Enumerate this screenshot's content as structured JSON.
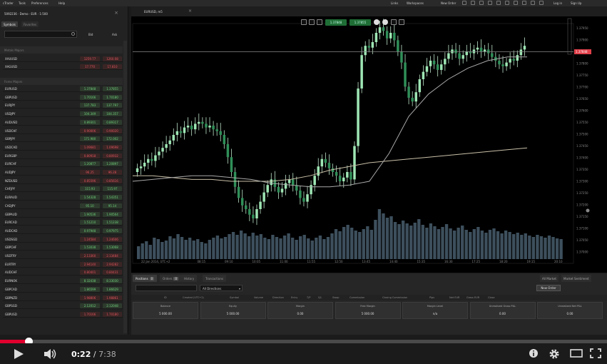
{
  "menubar": {
    "items": [
      "cTrader",
      "Tools",
      "Preferences",
      "Help"
    ],
    "right_items": [
      "Links",
      "Workspaces",
      "New Order",
      "Log in",
      "Sign Up"
    ]
  },
  "account": {
    "label": "5092236 · Demo · EUR · 1:500"
  },
  "symbol_tabs": [
    "Symbols",
    "Favorites"
  ],
  "quote_headers": {
    "bid": "Bid",
    "ask": "Ask"
  },
  "groups": [
    "Metals Majors",
    "Forex Majors"
  ],
  "quotes": [
    {
      "symbol": "XAUUSD",
      "bid": "1259.77",
      "ask": "1260.08",
      "trend": "down"
    },
    {
      "symbol": "XAGUSD",
      "bid": "17.770",
      "ask": "17.810",
      "trend": "down"
    },
    {
      "symbol": "EURUSD",
      "bid": "1.37848",
      "ask": "1.37855",
      "trend": "up"
    },
    {
      "symbol": "GBPUSD",
      "bid": "1.70166",
      "ask": "1.70180",
      "trend": "up"
    },
    {
      "symbol": "EURJPY",
      "bid": "137.783",
      "ask": "137.797",
      "trend": "up"
    },
    {
      "symbol": "USDJPY",
      "bid": "104.349",
      "ask": "104.357",
      "trend": "up"
    },
    {
      "symbol": "AUDUSD",
      "bid": "0.89301",
      "ask": "0.89317",
      "trend": "up"
    },
    {
      "symbol": "USDCHF",
      "bid": "0.90006",
      "ask": "0.90020",
      "trend": "down"
    },
    {
      "symbol": "GBPJPY",
      "bid": "171.980",
      "ask": "172.002",
      "trend": "up"
    },
    {
      "symbol": "USDCAD",
      "bid": "1.09681",
      "ask": "1.09698",
      "trend": "down"
    },
    {
      "symbol": "EURGBP",
      "bid": "0.80918",
      "ask": "0.80932",
      "trend": "down"
    },
    {
      "symbol": "EURCHF",
      "bid": "1.20877",
      "ask": "1.20897",
      "trend": "up"
    },
    {
      "symbol": "AUDJPY",
      "bid": "96.25",
      "ask": "96.28",
      "trend": "down"
    },
    {
      "symbol": "NZDUSD",
      "bid": "0.85596",
      "ask": "0.85616",
      "trend": "down"
    },
    {
      "symbol": "CHFJPY",
      "bid": "115.93",
      "ask": "115.97",
      "trend": "up"
    },
    {
      "symbol": "EURAUD",
      "bid": "1.54328",
      "ask": "1.54351",
      "trend": "up"
    },
    {
      "symbol": "CADJPY",
      "bid": "95.10",
      "ask": "95.14",
      "trend": "up"
    },
    {
      "symbol": "GBPAUD",
      "bid": "1.90536",
      "ask": "1.90564",
      "trend": "up"
    },
    {
      "symbol": "EURCAD",
      "bid": "1.51210",
      "ask": "1.51238",
      "trend": "up"
    },
    {
      "symbol": "AUDCAD",
      "bid": "0.97948",
      "ask": "0.97975",
      "trend": "up"
    },
    {
      "symbol": "USDSGD",
      "bid": "1.24584",
      "ask": "1.24606",
      "trend": "down"
    },
    {
      "symbol": "GBPCHF",
      "bid": "1.53038",
      "ask": "1.53068",
      "trend": "up"
    },
    {
      "symbol": "USDTRY",
      "bid": "2.13360",
      "ask": "2.13484",
      "trend": "down"
    },
    {
      "symbol": "EURTRY",
      "bid": "2.94140",
      "ask": "2.94282",
      "trend": "down"
    },
    {
      "symbol": "AUDCHF",
      "bid": "0.80401",
      "ask": "0.80431",
      "trend": "down"
    },
    {
      "symbol": "EURNOK",
      "bid": "8.32438",
      "ask": "8.33030",
      "trend": "up"
    },
    {
      "symbol": "GBPCAD",
      "bid": "1.86599",
      "ask": "1.86629",
      "trend": "up"
    },
    {
      "symbol": "GBPNZD",
      "bid": "1.98806",
      "ask": "1.98861",
      "trend": "down"
    },
    {
      "symbol": "GBPSGD",
      "bid": "2.12012",
      "ask": "2.12048",
      "trend": "up"
    },
    {
      "symbol": "GBPUSD",
      "bid": "1.70166",
      "ask": "1.70180",
      "trend": "down"
    }
  ],
  "chart_window": {
    "tab_label": "EURUSD, m5"
  },
  "chart_toolbar": {
    "sell_price": "1.37848",
    "buy_price": "1.37855"
  },
  "chart_data": {
    "type": "candlestick",
    "current_price": "1.37848",
    "y_ticks": [
      "1.37950",
      "1.37900",
      "1.37850",
      "1.37800",
      "1.37750",
      "1.37700",
      "1.37650",
      "1.37600",
      "1.37550",
      "1.37500",
      "1.37450",
      "1.37400",
      "1.37350",
      "1.37300",
      "1.37250",
      "1.37200",
      "1.37150",
      "1.37100",
      "1.37050",
      "1.37000"
    ],
    "x_ticks": [
      "22 Jan 2014, UTC+2",
      "08:15",
      "09:10",
      "10:05",
      "11:00",
      "11:55",
      "12:50",
      "13:45",
      "14:40",
      "15:35",
      "16:30",
      "17:25",
      "18:20",
      "19:15",
      "20:10"
    ],
    "closes": [
      1.3722,
      1.3723,
      1.3725,
      1.3727,
      1.3726,
      1.3729,
      1.3731,
      1.3733,
      1.3735,
      1.3737,
      1.374,
      1.3742,
      1.3741,
      1.3744,
      1.3745,
      1.3743,
      1.3746,
      1.3747,
      1.3746,
      1.3744,
      1.3745,
      1.3743,
      1.3742,
      1.374,
      1.3735,
      1.3728,
      1.372,
      1.3712,
      1.3706,
      1.3702,
      1.37,
      1.3697,
      1.3695,
      1.37,
      1.3704,
      1.3709,
      1.3713,
      1.3716,
      1.3712,
      1.3709,
      1.3711,
      1.3714,
      1.3716,
      1.3713,
      1.371,
      1.3706,
      1.3704,
      1.3708,
      1.3713,
      1.3718,
      1.3723,
      1.3727,
      1.3725,
      1.3722,
      1.372,
      1.3718,
      1.3715,
      1.3717,
      1.372,
      1.3716,
      1.3734,
      1.3765,
      1.3783,
      1.3788,
      1.3787,
      1.379,
      1.3795,
      1.3798,
      1.3796,
      1.3792,
      1.3795,
      1.3791,
      1.3785,
      1.3779,
      1.3766,
      1.376,
      1.3758,
      1.3763,
      1.377,
      1.3774,
      1.3777,
      1.378,
      1.3778,
      1.3775,
      1.3778,
      1.3781,
      1.3784,
      1.3786,
      1.3784,
      1.3781,
      1.3783,
      1.3785,
      1.3784,
      1.3786,
      1.3787,
      1.3785,
      1.3786,
      1.3784,
      1.3782,
      1.378,
      1.3778,
      1.3777,
      1.3779,
      1.3781,
      1.378,
      1.3783,
      1.3786,
      1.3788
    ],
    "ma_fast": [
      1.3715,
      1.3716,
      1.3717,
      1.3718,
      1.3718,
      1.3717,
      1.3716,
      1.3714,
      1.3713,
      1.3712,
      1.3712,
      1.3713,
      1.3715,
      1.373,
      1.375,
      1.3762,
      1.377,
      1.3776,
      1.378,
      1.3782,
      1.3782
    ],
    "ma_slow": [
      1.3718,
      1.3718,
      1.3717,
      1.3716,
      1.3716,
      1.3715,
      1.3715,
      1.3715,
      1.3716,
      1.3718,
      1.3721,
      1.3723,
      1.3725,
      1.3726,
      1.3727,
      1.3728,
      1.3729,
      1.373,
      1.3731,
      1.3732,
      1.3733
    ],
    "volume": [
      18,
      22,
      25,
      20,
      30,
      28,
      24,
      26,
      32,
      29,
      35,
      31,
      27,
      30,
      26,
      28,
      24,
      22,
      27,
      30,
      33,
      29,
      31,
      35,
      38,
      34,
      40,
      36,
      32,
      37,
      33,
      35,
      30,
      28,
      34,
      31,
      29,
      33,
      36,
      30,
      27,
      32,
      34,
      29,
      26,
      30,
      33,
      28,
      31,
      36,
      42,
      39,
      45,
      48,
      44,
      40,
      38,
      42,
      46,
      41,
      55,
      70,
      64,
      58,
      60,
      52,
      49,
      54,
      50,
      47,
      51,
      56,
      48,
      44,
      50,
      46,
      42,
      45,
      49,
      43,
      40,
      44,
      47,
      41,
      38,
      42,
      45,
      40,
      37,
      41,
      43,
      39,
      36,
      40,
      38,
      35,
      37,
      34,
      36,
      33,
      31,
      34,
      32,
      30,
      33,
      31,
      29,
      28
    ],
    "ylim": [
      1.369,
      1.38
    ]
  },
  "bottom_panel": {
    "tabs": [
      {
        "label": "Positions",
        "badge": "0"
      },
      {
        "label": "Orders",
        "badge": "0"
      },
      {
        "label": "History",
        "badge": ""
      },
      {
        "label": "Transactions",
        "badge": ""
      }
    ],
    "right_tabs": [
      "All Market",
      "Market Sentiment",
      "Watchlist"
    ],
    "filter_direction": "All Directions",
    "new_order_label": "New Order",
    "columns": [
      "ID",
      "Created (UTC+2)",
      "Symbol",
      "Volume",
      "Direction",
      "Entry",
      "T/P",
      "S/L",
      "Swap",
      "Commission",
      "Closing Commission",
      "Pips",
      "Net EUR",
      "Gross EUR",
      "Close"
    ],
    "summary": [
      {
        "label": "Balance",
        "value": "5 000.00"
      },
      {
        "label": "Equity",
        "value": "5 000.00"
      },
      {
        "label": "Margin",
        "value": "0.00"
      },
      {
        "label": "Free Margin",
        "value": "5 000.00"
      },
      {
        "label": "Margin Level",
        "value": "n/a"
      },
      {
        "label": "Unrealized Gross P&L",
        "value": "0.00"
      },
      {
        "label": "Unrealized Net P&L",
        "value": "0.00"
      }
    ]
  },
  "player": {
    "current_time": "0:22",
    "separator": " / ",
    "duration": "7:38",
    "progress": 0.048
  }
}
